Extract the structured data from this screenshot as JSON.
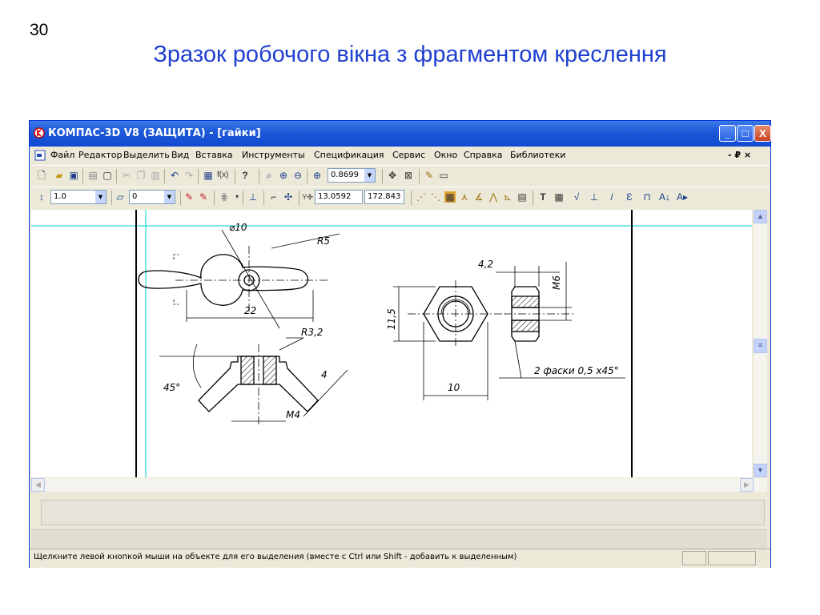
{
  "slide": {
    "number": "30",
    "title": "Зразок робочого вікна з фрагментом креслення"
  },
  "window": {
    "title": "КОМПАС-3D V8 (ЗАЩИТА) - [гайки]",
    "controls": {
      "minimize": "_",
      "maximize": "□",
      "close": "X"
    }
  },
  "menu": {
    "items": [
      "Файл",
      "Редактор",
      "Выделить",
      "Вид",
      "Вставка",
      "Инструменты",
      "Спецификация",
      "Сервис",
      "Окно",
      "Справка",
      "Библиотеки"
    ],
    "doc_controls": "- ₽ ×"
  },
  "toolbar1": {
    "zoom_value": "0.8699"
  },
  "toolbar2": {
    "line_width": "1.0",
    "layer": "0",
    "coord_x": "13.0592",
    "coord_y": "172.843"
  },
  "drawing": {
    "labels": {
      "diam": "⌀10",
      "r5": "R5",
      "w22": "22",
      "r32": "R3,2",
      "angle": "45°",
      "thread_m4": "M4",
      "four": "4",
      "d42": "4,2",
      "m6": "M6",
      "h115": "11,5",
      "w10": "10",
      "chamfer": "2 фаски 0,5 х45°"
    }
  },
  "status": {
    "text": "Щелкните левой кнопкой мыши на объекте для его выделения (вместе с Ctrl или Shift - добавить к выделенным)"
  },
  "colors": {
    "title_blue": "#1f3fd0",
    "xp_titlebar": "#0f4ad1",
    "xp_face": "#ece9d8",
    "guide_cyan": "#00c8d8"
  }
}
